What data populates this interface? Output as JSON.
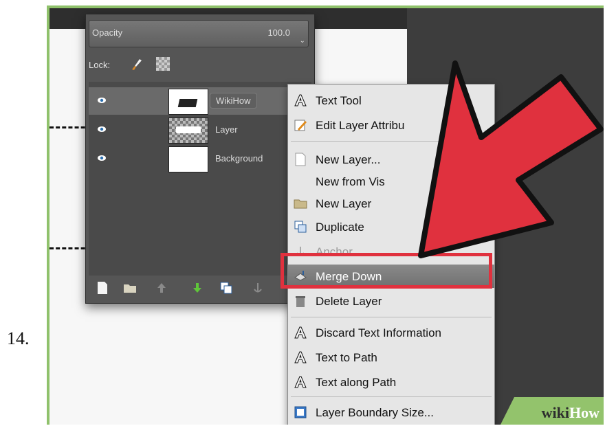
{
  "step": {
    "number": "14."
  },
  "panel": {
    "opacity_label": "Opacity",
    "opacity_value": "100.0",
    "lock_label": "Lock:",
    "layers": [
      {
        "name": "WikiHow",
        "selected": true
      },
      {
        "name": "Layer",
        "selected": false
      },
      {
        "name": "Background",
        "selected": false
      }
    ]
  },
  "menu": {
    "items": [
      {
        "label": "Text Tool",
        "icon": "text-icon"
      },
      {
        "label": "Edit Layer Attribu",
        "icon": "edit-attributes-icon"
      },
      {
        "label": "New Layer...",
        "icon": "new-layer-icon"
      },
      {
        "label": "New from Vis",
        "icon": ""
      },
      {
        "label": "New Layer",
        "icon": "folder-icon"
      },
      {
        "label": "Duplicate",
        "icon": "duplicate-icon"
      },
      {
        "label": "Anchor",
        "icon": "anchor-icon",
        "disabled": true
      },
      {
        "label": "Merge Down",
        "icon": "merge-down-icon",
        "highlighted": true
      },
      {
        "label": "Delete Layer",
        "icon": "delete-icon"
      },
      {
        "label": "Discard Text Information",
        "icon": "text-icon"
      },
      {
        "label": "Text to Path",
        "icon": "text-icon"
      },
      {
        "label": "Text along Path",
        "icon": "text-icon"
      },
      {
        "label": "Layer Boundary Size...",
        "icon": "boundary-icon"
      }
    ]
  },
  "logo": {
    "wiki": "wiki",
    "how": "How"
  },
  "colors": {
    "accent_red": "#e0313e",
    "frame_green": "#8fc16b"
  }
}
